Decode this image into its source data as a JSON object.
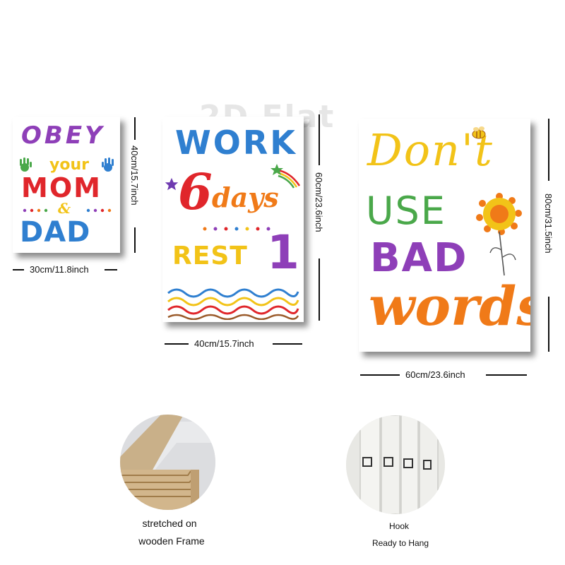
{
  "watermark": "2D Flat",
  "posters": [
    {
      "id": "small",
      "lines": [
        "OBEY",
        "your",
        "MOM",
        "&",
        "DAD"
      ],
      "width_label": "30cm/11.8inch",
      "height_label": "40cm/15.7inch"
    },
    {
      "id": "medium",
      "lines": [
        "WORK",
        "6",
        "days",
        "REST",
        "1"
      ],
      "width_label": "40cm/15.7inch",
      "height_label": "60cm/23.6inch"
    },
    {
      "id": "large",
      "lines": [
        "Don't",
        "USE",
        "BAD",
        "words"
      ],
      "width_label": "60cm/23.6inch",
      "height_label": "80cm/31.5inch"
    }
  ],
  "details": [
    {
      "id": "frame",
      "caption_lines": [
        "stretched on",
        "wooden Frame"
      ]
    },
    {
      "id": "hook",
      "caption_lines": [
        "Hook",
        "Ready to Hang"
      ]
    }
  ],
  "colors": {
    "purple": "#8e3fb8",
    "yellow": "#f2c318",
    "red": "#e0262b",
    "blue": "#2f7fd0",
    "green": "#4aa84a",
    "orange": "#f07a18"
  }
}
